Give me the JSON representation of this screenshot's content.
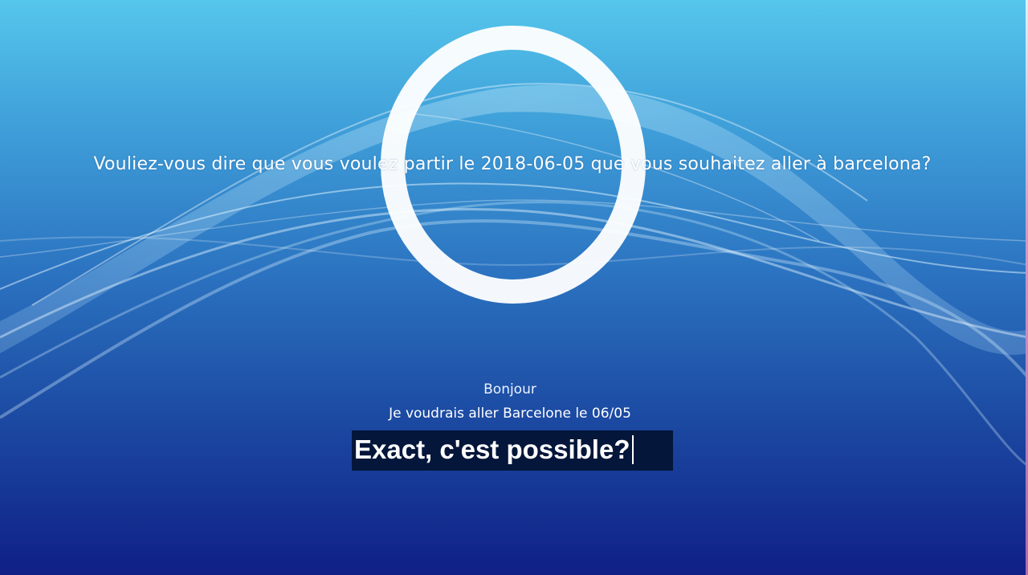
{
  "assistant": {
    "prompt": "Vouliez-vous dire que vous voulez partir le 2018-06-05 que vous souhaitez aller à barcelona?"
  },
  "conversation": {
    "messages": [
      "Bonjour",
      "Je voudrais aller  Barcelone le 06/05"
    ]
  },
  "input": {
    "value": "Exact, c'est possible?"
  },
  "colors": {
    "background_top": "#55c6ec",
    "background_bottom": "#0f1f86",
    "input_background": "#04163a",
    "text": "#ffffff"
  },
  "icons": {
    "ring": "listening-ring-icon"
  }
}
